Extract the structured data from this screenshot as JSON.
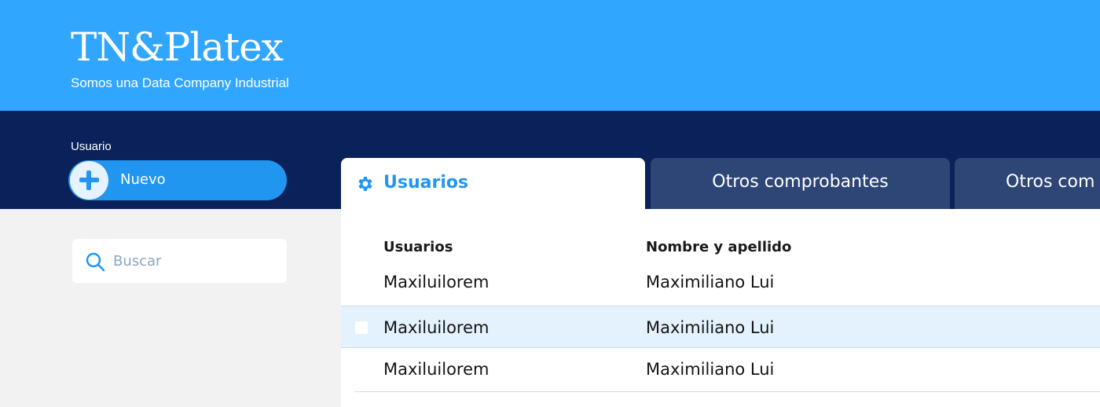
{
  "header": {
    "brand": "TN&Platex",
    "tagline": "Somos una Data Company Industrial"
  },
  "sidebar": {
    "section_label": "Usuario",
    "new_button_label": "Nuevo",
    "search_placeholder": "Buscar"
  },
  "tabs": [
    {
      "label": "Usuarios",
      "icon": "gear-icon",
      "active": true
    },
    {
      "label": "Otros comprobantes",
      "active": false
    },
    {
      "label": "Otros com",
      "active": false
    }
  ],
  "table": {
    "columns": [
      "Usuarios",
      "Nombre y apellido"
    ],
    "rows": [
      {
        "usuario": "Maxiluilorem",
        "nombre": "Maximiliano Lui",
        "selected": false
      },
      {
        "usuario": "Maxiluilorem",
        "nombre": "Maximiliano Lui",
        "selected": true
      },
      {
        "usuario": "Maxiluilorem",
        "nombre": "Maximiliano Lui",
        "selected": false
      }
    ]
  },
  "colors": {
    "header_bg": "#30a6ff",
    "nav_bg": "#0a2159",
    "accent": "#2196f0",
    "inactive_tab": "#2d4676",
    "selected_row": "#e3f2fd"
  }
}
